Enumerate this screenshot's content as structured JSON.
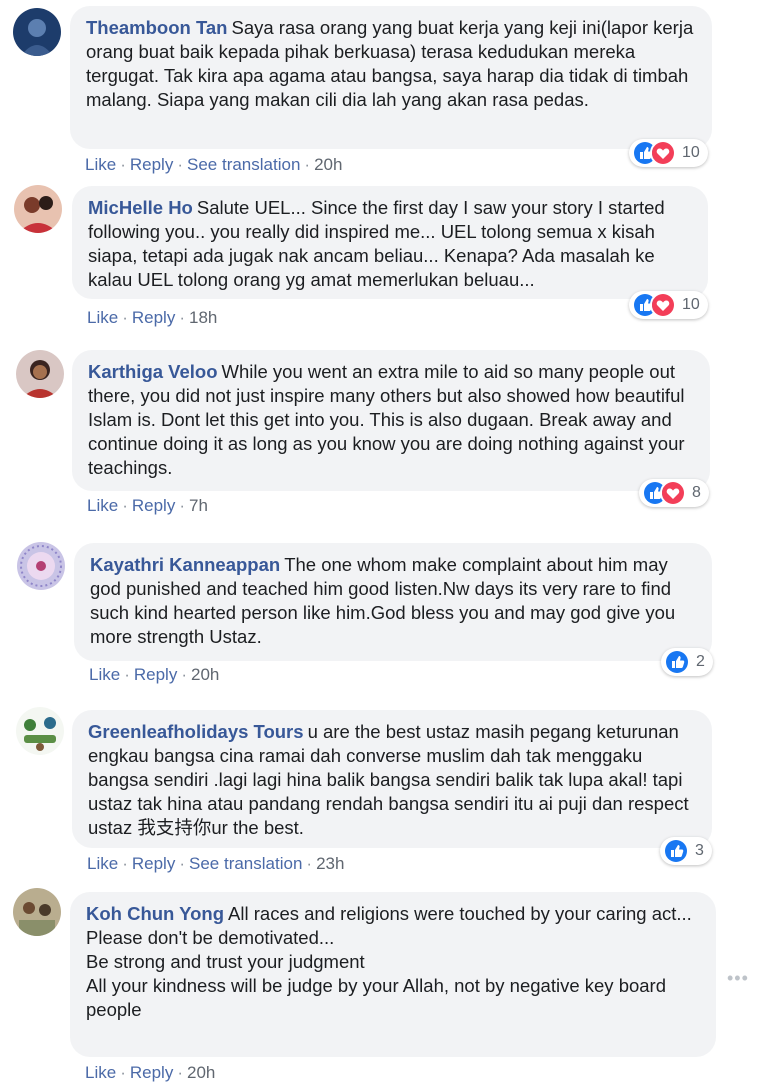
{
  "colors": {
    "link": "#385898",
    "bubble": "#f2f3f5",
    "like_blue": "#1877f2",
    "love_red": "#f33e58"
  },
  "comments": [
    {
      "author": "Theamboon Tan",
      "text": "Saya rasa orang yang buat kerja yang keji ini(lapor kerja orang buat baik kepada pihak berkuasa) terasa kedudukan mereka tergugat. Tak kira apa agama atau bangsa, saya harap dia tidak di timbah malang. Siapa yang makan cili dia lah yang akan rasa pedas.",
      "like": "Like",
      "reply": "Reply",
      "translate": "See translation",
      "time": "20h",
      "reaction_icons": [
        "like-icon",
        "love-icon"
      ],
      "reaction_count": "10"
    },
    {
      "author": "MicHelle Ho",
      "text": "Salute UEL... Since the first day I saw your story I started following you.. you really did inspired me... UEL tolong semua x kisah siapa, tetapi ada jugak nak ancam beliau... Kenapa? Ada masalah ke kalau UEL tolong orang yg amat memerlukan beluau...",
      "like": "Like",
      "reply": "Reply",
      "time": "18h",
      "reaction_icons": [
        "like-icon",
        "love-icon"
      ],
      "reaction_count": "10"
    },
    {
      "author": "Karthiga Veloo",
      "text": "While you went an extra mile to aid so many people out there, you did not just inspire many others but also showed how beautiful Islam is. Dont let this get into you. This is also dugaan. Break away and continue doing it as long as you know you are doing nothing against your teachings.",
      "like": "Like",
      "reply": "Reply",
      "time": "7h",
      "reaction_icons": [
        "like-icon",
        "love-icon"
      ],
      "reaction_count": "8"
    },
    {
      "author": "Kayathri Kanneappan",
      "text": "The one whom make complaint about him may god punished and teached him good listen.Nw days its very rare to find such kind hearted person like him.God bless you and may god give you more strength Ustaz.",
      "like": "Like",
      "reply": "Reply",
      "time": "20h",
      "reaction_icons": [
        "like-icon"
      ],
      "reaction_count": "2"
    },
    {
      "author": "Greenleafholidays Tours",
      "text_before": "u are the best ustaz masih pegang keturunan engkau bangsa cina ramai dah converse muslim dah tak menggaku bangsa sendiri .lagi lagi hina balik bangsa sendiri balik tak lupa akal! tapi ustaz tak hina atau pandang rendah bangsa sendiri itu ai puji dan respect ustaz ",
      "text_cn": "我支持你",
      "text_after": "ur the best.",
      "like": "Like",
      "reply": "Reply",
      "translate": "See translation",
      "time": "23h",
      "reaction_icons": [
        "like-icon"
      ],
      "reaction_count": "3"
    },
    {
      "author": "Koh Chun Yong",
      "text_first": "All races and religions were touched by your caring act...",
      "text_rest": "Please don't be demotivated...\nBe strong and trust your judgment\nAll your kindness will be judge by your Allah, not by negative key board people",
      "like": "Like",
      "reply": "Reply",
      "time": "20h"
    }
  ],
  "more_menu": "more-options-icon"
}
